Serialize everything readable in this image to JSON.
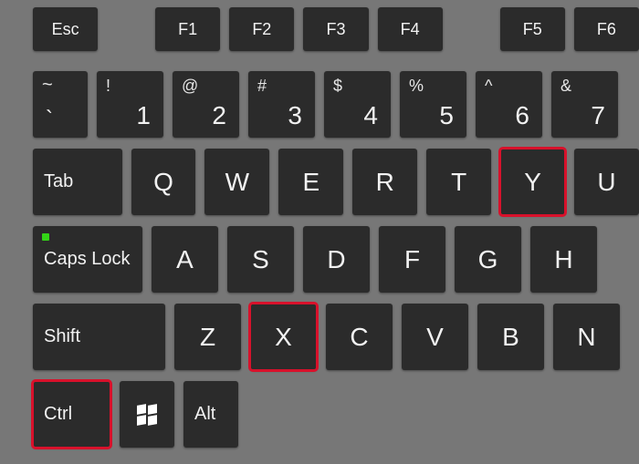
{
  "fn_row": {
    "esc": "Esc",
    "f1": "F1",
    "f2": "F2",
    "f3": "F3",
    "f4": "F4",
    "f5": "F5",
    "f6": "F6"
  },
  "num_row": {
    "tilde": {
      "upper": "~",
      "lower": "`"
    },
    "k1": {
      "sym": "!",
      "digit": "1"
    },
    "k2": {
      "sym": "@",
      "digit": "2"
    },
    "k3": {
      "sym": "#",
      "digit": "3"
    },
    "k4": {
      "sym": "$",
      "digit": "4"
    },
    "k5": {
      "sym": "%",
      "digit": "5"
    },
    "k6": {
      "sym": "^",
      "digit": "6"
    },
    "k7": {
      "sym": "&",
      "digit": "7"
    }
  },
  "qwerty_row": {
    "tab": "Tab",
    "q": "Q",
    "w": "W",
    "e": "E",
    "r": "R",
    "t": "T",
    "y": "Y",
    "u": "U"
  },
  "home_row": {
    "caps": "Caps Lock",
    "a": "A",
    "s": "S",
    "d": "D",
    "f": "F",
    "g": "G",
    "h": "H"
  },
  "bottom_row": {
    "shift": "Shift",
    "z": "Z",
    "x": "X",
    "c": "C",
    "v": "V",
    "b": "B",
    "n": "N"
  },
  "mod_row": {
    "ctrl": "Ctrl",
    "alt": "Alt"
  },
  "highlighted_keys": [
    "ctrl",
    "x",
    "y"
  ]
}
